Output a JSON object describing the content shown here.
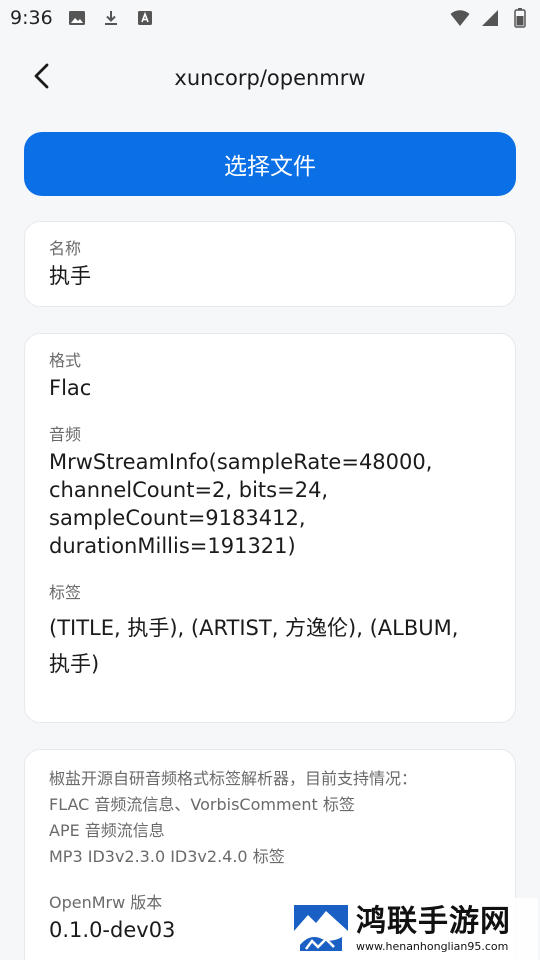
{
  "status_bar": {
    "time": "9:36",
    "left_icons": [
      "image-icon",
      "download-icon",
      "font-a-icon"
    ],
    "right_icons": [
      "wifi-icon",
      "signal-icon",
      "battery-icon"
    ]
  },
  "app_bar": {
    "back_icon": "chevron-left-icon",
    "title": "xuncorp/openmrw"
  },
  "select_button": {
    "label": "选择文件"
  },
  "name_card": {
    "label": "名称",
    "value": "执手"
  },
  "details_card": {
    "format_label": "格式",
    "format_value": "Flac",
    "audio_label": "音频",
    "audio_lines": [
      "MrwStreamInfo(sampleRate=48000,",
      "channelCount=2, bits=24,",
      "sampleCount=9183412,",
      "durationMillis=191321)"
    ],
    "tags_label": "标签",
    "tags_lines": [
      "(TITLE, 执手), (ARTIST, 方逸伦), (ALBUM,",
      "执手)"
    ]
  },
  "about_card": {
    "info_lines": [
      "椒盐开源自研音频格式标签解析器，目前支持情况：",
      "FLAC 音频流信息、VorbisComment 标签",
      "APE 音频流信息",
      "MP3 ID3v2.3.0 ID3v2.4.0 标签"
    ],
    "version_label": "OpenMrw 版本",
    "version_value": "0.1.0-dev03"
  },
  "watermark": {
    "title": "鸿联手游网",
    "url": "www.henanhonglian95.com"
  },
  "colors": {
    "accent": "#0b6fe6",
    "background": "#f6f7f9",
    "card": "#ffffff",
    "secondary_text": "#6a6a6a"
  }
}
